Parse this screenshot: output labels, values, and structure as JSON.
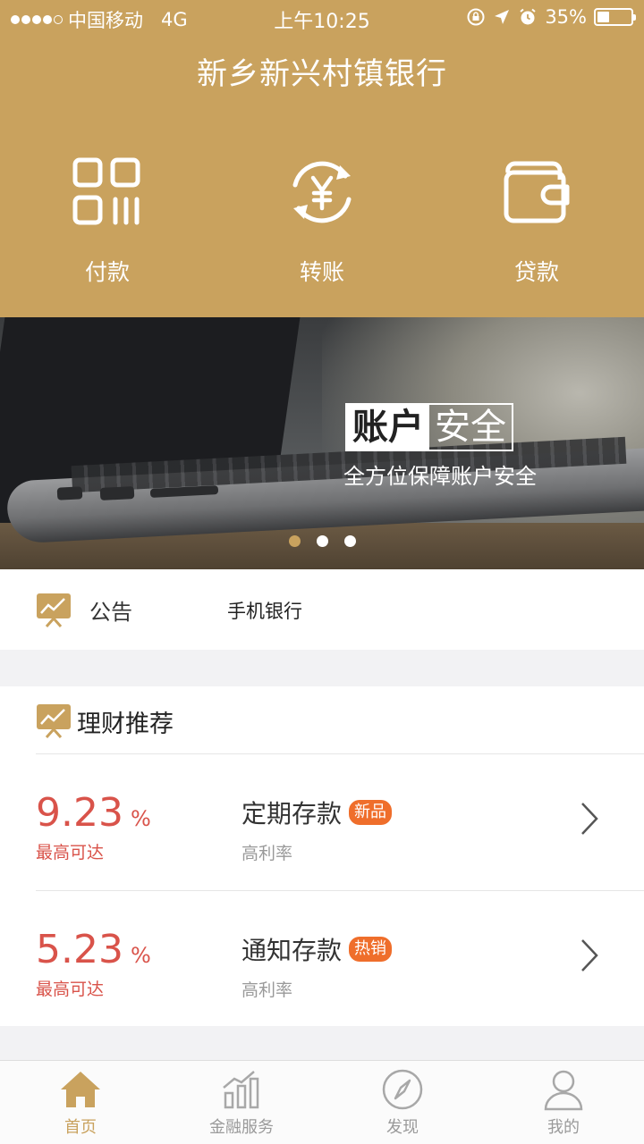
{
  "status_bar": {
    "carrier": "中国移动",
    "network": "4G",
    "time": "上午10:25",
    "battery": "35%",
    "battery_level": 0.35
  },
  "header": {
    "title": "新乡新兴村镇银行"
  },
  "quick_actions": [
    {
      "label": "付款",
      "icon": "qr-code-icon"
    },
    {
      "label": "转账",
      "icon": "yuan-transfer-icon"
    },
    {
      "label": "贷款",
      "icon": "wallet-icon"
    }
  ],
  "banner": {
    "headline_highlight": "账户",
    "headline_rest": "安全",
    "subline": "全方位保障账户安全",
    "slide_count": 3,
    "active_slide": 1
  },
  "notice": {
    "label": "公告",
    "text": "手机银行"
  },
  "wealth": {
    "title": "理财推荐",
    "products": [
      {
        "rate": "9.23",
        "unit": "%",
        "rate_label": "最高可达",
        "name": "定期存款",
        "tag": "新品",
        "subtitle": "高利率"
      },
      {
        "rate": "5.23",
        "unit": "%",
        "rate_label": "最高可达",
        "name": "通知存款",
        "tag": "热销",
        "subtitle": "高利率"
      }
    ]
  },
  "tabbar": {
    "tabs": [
      {
        "label": "首页",
        "icon": "home-icon",
        "active": true
      },
      {
        "label": "金融服务",
        "icon": "chart-bars-icon",
        "active": false
      },
      {
        "label": "发现",
        "icon": "compass-icon",
        "active": false
      },
      {
        "label": "我的",
        "icon": "user-icon",
        "active": false
      }
    ]
  },
  "colors": {
    "brand": "#c9a25e",
    "rate_red": "#d9534a",
    "tag_orange": "#ef6e2b"
  }
}
